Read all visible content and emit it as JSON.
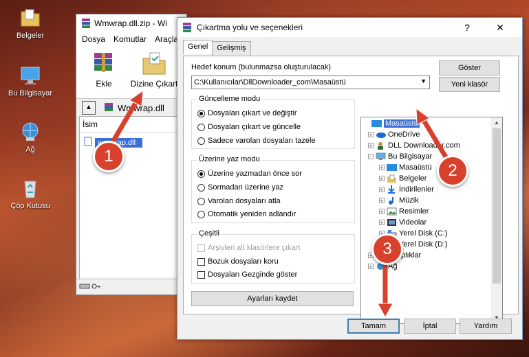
{
  "desktop": {
    "icons": [
      {
        "label": "Belgeler",
        "icon": "documents-folder-icon"
      },
      {
        "label": "Bu Bilgisayar",
        "icon": "computer-icon"
      },
      {
        "label": "Ağ",
        "icon": "network-icon"
      },
      {
        "label": "Çöp Kutusu",
        "icon": "recycle-bin-icon"
      }
    ]
  },
  "rar": {
    "title": "Wmwrap.dll.zip - Wi",
    "menu": [
      "Dosya",
      "Komutlar",
      "Araçla"
    ],
    "toolbar": {
      "add": "Ekle",
      "extract": "Dizine Çıkart"
    },
    "path": "Wmwrap.dll",
    "column": "İsim",
    "file": "wmwrap.dll"
  },
  "dialog": {
    "title": "Çıkartma yolu ve seçenekleri",
    "help_glyph": "?",
    "close_glyph": "✕",
    "tabs": [
      "Genel",
      "Gelişmiş"
    ],
    "dest_label": "Hedef konum (bulunmazsa oluşturulacak)",
    "dest_value": "C:\\Kullanıcılar\\DllDownloader_com\\Masaüstü",
    "show_btn": "Göster",
    "newfolder_btn": "Yeni klasör",
    "update": {
      "title": "Güncelleme modu",
      "options": [
        "Dosyaları çıkart ve değiştir",
        "Dosyaları çıkart ve güncelle",
        "Sadece varolan dosyaları tazele"
      ],
      "selected": 0
    },
    "overwrite": {
      "title": "Üzerine yaz modu",
      "options": [
        "Üzerine yazmadan önce sor",
        "Sormadan üzerine yaz",
        "Varolan dosyaları atla",
        "Otomatik yeniden adlandır"
      ],
      "selected": 0
    },
    "misc": {
      "title": "Çeşitli",
      "options": [
        "Arşivleri alt klasörlere çıkart",
        "Bozuk dosyaları koru",
        "Dosyaları Gezginde göster"
      ]
    },
    "save_btn": "Ayarları kaydet",
    "tree": [
      {
        "label": "Masaüstü",
        "selected": true
      },
      {
        "label": "OneDrive"
      },
      {
        "label": "DLL Downloader.com"
      },
      {
        "label": "Bu Bilgisayar"
      },
      {
        "label": "Masaüstü"
      },
      {
        "label": "Belgeler"
      },
      {
        "label": "İndirilenler"
      },
      {
        "label": "Müzik"
      },
      {
        "label": "Resimler"
      },
      {
        "label": "Videolar"
      },
      {
        "label": "Yerel Disk (C:)"
      },
      {
        "label": "Yerel Disk (D:)"
      },
      {
        "label": "Kitaplıklar"
      },
      {
        "label": "Ağ"
      }
    ],
    "ok_btn": "Tamam",
    "cancel_btn": "İptal",
    "help_btn": "Yardım"
  },
  "steps": [
    "1",
    "2",
    "3"
  ],
  "colors": {
    "step_badge": "#d9412f",
    "selection": "#3a6fd8",
    "default_button_border": "#3c7fb1"
  }
}
